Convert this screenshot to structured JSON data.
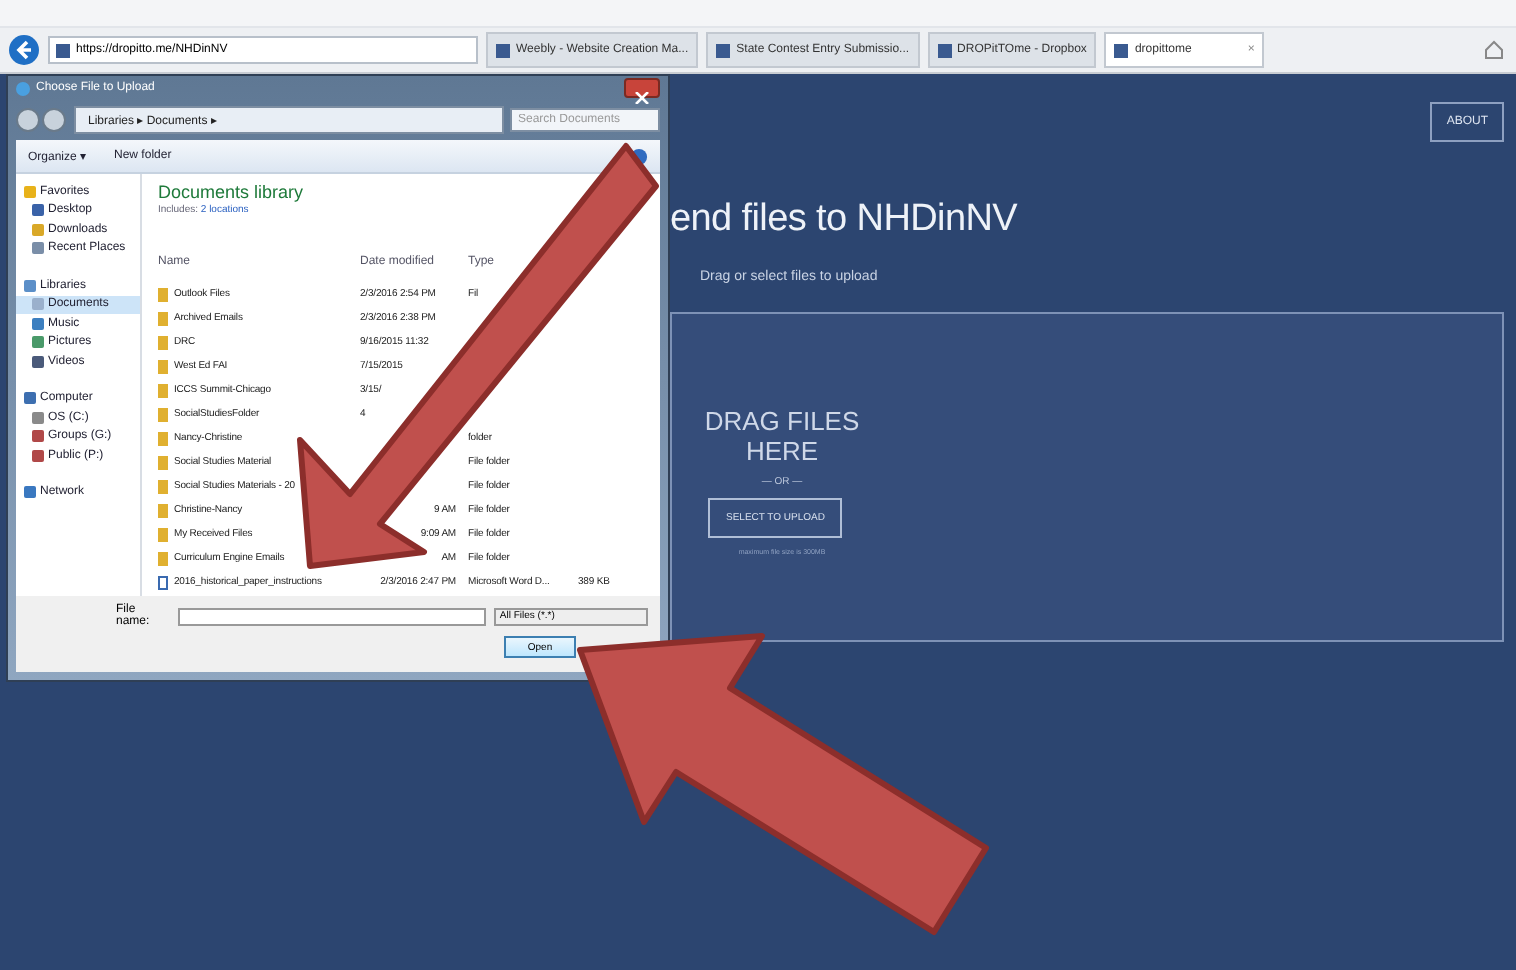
{
  "browser": {
    "url": "https://dropitto.me/NHDinNV",
    "tabs": [
      {
        "label": "Weebly - Website Creation Ma...",
        "selected": false
      },
      {
        "label": "State Contest Entry Submissio...",
        "selected": false
      },
      {
        "label": "DROPitTOme - Dropbox",
        "selected": false
      },
      {
        "label": "dropittome",
        "selected": true,
        "close": "×"
      }
    ]
  },
  "page": {
    "about": "ABOUT",
    "heading": "end files to NHDinNV",
    "subtitle": "Drag or select files to upload",
    "drop_title": "DRAG FILES HERE",
    "or": "— OR —",
    "select_button": "SELECT TO UPLOAD",
    "note": "maximum file size is 300MB"
  },
  "dialog": {
    "title": "Choose File to Upload",
    "breadcrumb": "Libraries ▸ Documents ▸",
    "search": {
      "placeholder": "Search Documents"
    },
    "toolbar": [
      "Organize ▾",
      "New folder"
    ],
    "nav": [
      {
        "label": "Favorites",
        "selected": false,
        "children": [
          {
            "label": "Desktop",
            "selected": false
          },
          {
            "label": "Downloads",
            "selected": false
          },
          {
            "label": "Recent Places",
            "selected": false
          }
        ]
      },
      {
        "label": "Libraries",
        "selected": false,
        "children": [
          {
            "label": "Documents",
            "selected": true
          },
          {
            "label": "Music",
            "selected": false
          },
          {
            "label": "Pictures",
            "selected": false
          },
          {
            "label": "Videos",
            "selected": false
          }
        ]
      },
      {
        "label": "Computer",
        "selected": false,
        "children": [
          {
            "label": "OS (C:)",
            "selected": false
          },
          {
            "label": "Groups (G:)",
            "selected": false
          },
          {
            "label": "Public (P:)",
            "selected": false
          }
        ]
      },
      {
        "label": "Network",
        "selected": false
      }
    ],
    "library_title": "Documents library",
    "includes": "Includes:",
    "locations": "2 locations",
    "columns": [
      "Name",
      "Date modified",
      "Type"
    ],
    "rows": [
      {
        "kind": "folder",
        "name": "Outlook Files",
        "date": "2/3/2016 2:54 PM",
        "type": "Fil"
      },
      {
        "kind": "folder",
        "name": "Archived Emails",
        "date": "2/3/2016 2:38 PM"
      },
      {
        "kind": "folder",
        "name": "DRC",
        "date": "9/16/2015 11:32"
      },
      {
        "kind": "folder",
        "name": "West Ed FAI",
        "date": "7/15/2015"
      },
      {
        "kind": "folder",
        "name": "ICCS Summit-Chicago",
        "date": "3/15/"
      },
      {
        "kind": "folder",
        "name": "SocialStudiesFolder",
        "date": "4"
      },
      {
        "kind": "folder",
        "name": "Nancy-Christine",
        "type": "folder"
      },
      {
        "kind": "folder",
        "name": "Social Studies Material",
        "type": "File folder"
      },
      {
        "kind": "folder",
        "name": "Social Studies Materials - 20",
        "type": "File folder"
      },
      {
        "kind": "folder",
        "name": "Christine-Nancy",
        "date": "9 AM",
        "type": "File folder"
      },
      {
        "kind": "folder",
        "name": "My Received Files",
        "date": "9:09 AM",
        "type": "File folder"
      },
      {
        "kind": "folder",
        "name": "Curriculum Engine Emails",
        "date": "AM",
        "type": "File folder"
      },
      {
        "kind": "doc",
        "name": "2016_historical_paper_instructions",
        "date": "2/3/2016 2:47 PM",
        "type": "Microsoft Word D...",
        "size": "389 KB"
      }
    ],
    "filename_label": "File name:",
    "filter": "All Files (*.*)",
    "open": "Open"
  }
}
